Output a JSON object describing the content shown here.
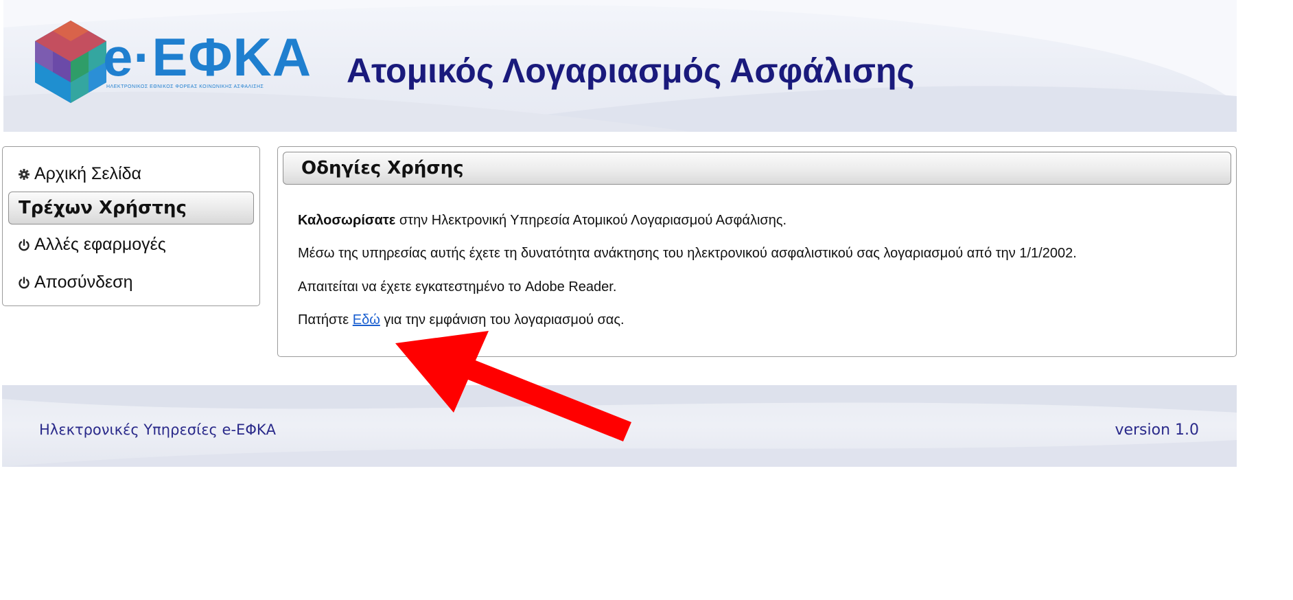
{
  "header": {
    "logo_text": "e·ΕΦΚΑ",
    "logo_subtitle": "ΗΛΕΚΤΡΟΝΙΚΟΣ ΕΘΝΙΚΟΣ ΦΟΡΕΑΣ ΚΟΙΝΩΝΙΚΗΣ ΑΣΦΑΛΙΣΗΣ",
    "title": "Ατομικός Λογαριασμός Ασφάλισης"
  },
  "sidebar": {
    "items": [
      {
        "label": "Αρχική Σελίδα",
        "icon": "gear-icon"
      },
      {
        "label": "Τρέχων Χρήστης",
        "active": true
      },
      {
        "label": "Αλλές εφαρμογές",
        "icon": "power-icon"
      },
      {
        "label": "Αποσύνδεση",
        "icon": "power-icon"
      }
    ]
  },
  "main": {
    "heading": "Οδηγίες Χρήσης",
    "welcome_bold": "Καλοσωρίσατε",
    "welcome_rest": " στην Ηλεκτρονική Υπηρεσία Ατομικού Λογαριασμού Ασφάλισης.",
    "line2": "Μέσω της υπηρεσίας αυτής έχετε τη δυνατότητα ανάκτησης του ηλεκτρονικού ασφαλιστικού σας λογαριασμού από την 1/1/2002.",
    "line3": "Απαιτείται να έχετε εγκατεστημένο το Adobe Reader.",
    "line4_before": "Πατήστε ",
    "line4_link": "Εδώ",
    "line4_after": " για την εμφάνιση του λογαριασμού σας."
  },
  "footer": {
    "left": "Ηλεκτρονικές Υπηρεσίες e-ΕΦΚΑ",
    "right": "version 1.0"
  },
  "colors": {
    "title": "#1a1a7c",
    "logo": "#1f7fcf",
    "link": "#1a5fd0",
    "arrow": "#ff0000",
    "footer_text": "#2a2a8a"
  }
}
